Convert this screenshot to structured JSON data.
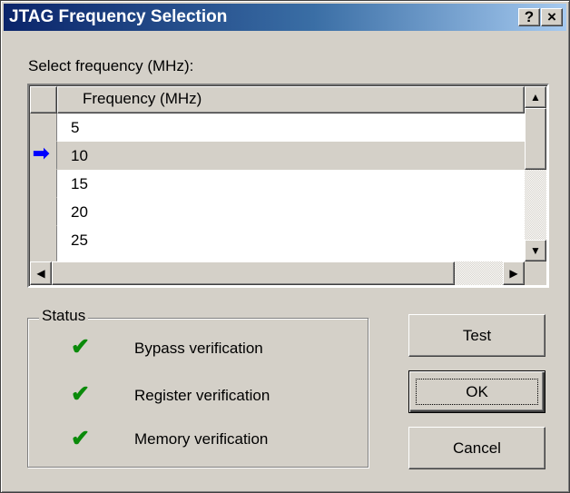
{
  "window": {
    "title": "JTAG Frequency Selection",
    "help_button": "?",
    "close_button": "×"
  },
  "selection": {
    "label": "Select frequency (MHz):",
    "column_header": "Frequency (MHz)",
    "rows": [
      "5",
      "10",
      "15",
      "20",
      "25"
    ],
    "selected_value": "10",
    "selected_indicator": "➡"
  },
  "status": {
    "title": "Status",
    "items": [
      {
        "check": "✔",
        "label": "Bypass verification"
      },
      {
        "check": "✔",
        "label": "Register verification"
      },
      {
        "check": "✔",
        "label": "Memory verification"
      }
    ]
  },
  "buttons": {
    "test": "Test",
    "ok": "OK",
    "cancel": "Cancel"
  },
  "scroll": {
    "up_arrow": "▲",
    "down_arrow": "▼",
    "left_arrow": "◀",
    "right_arrow": "▶"
  },
  "colors": {
    "title_gradient_start": "#0a246a",
    "title_gradient_end": "#a6caf0",
    "check_green": "#0a8a0a",
    "indicator_blue": "#0000ff"
  }
}
